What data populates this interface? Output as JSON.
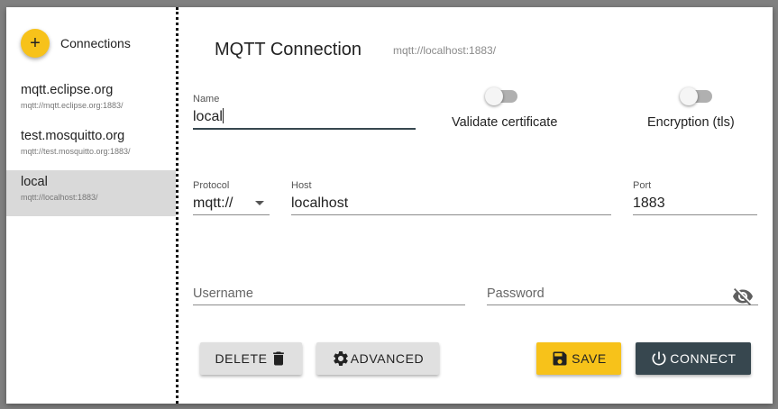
{
  "sidebar": {
    "title": "Connections",
    "add_icon": "plus-icon",
    "connections": [
      {
        "name": "mqtt.eclipse.org",
        "url": "mqtt://mqtt.eclipse.org:1883/"
      },
      {
        "name": "test.mosquitto.org",
        "url": "mqtt://test.mosquitto.org:1883/"
      },
      {
        "name": "local",
        "url": "mqtt://localhost:1883/",
        "selected": true
      }
    ]
  },
  "main": {
    "title": "MQTT Connection",
    "url": "mqtt://localhost:1883/",
    "name_field": {
      "label": "Name",
      "value": "local"
    },
    "validate_certificate": {
      "label": "Validate certificate",
      "enabled": false
    },
    "encryption": {
      "label": "Encryption (tls)",
      "enabled": false
    },
    "protocol": {
      "label": "Protocol",
      "value": "mqtt://"
    },
    "host": {
      "label": "Host",
      "value": "localhost"
    },
    "port": {
      "label": "Port",
      "value": "1883"
    },
    "username": {
      "placeholder": "Username"
    },
    "password": {
      "placeholder": "Password",
      "icon": "visibility-off-icon"
    }
  },
  "buttons": {
    "delete": {
      "label": "DELETE",
      "icon": "trash-icon"
    },
    "advanced": {
      "label": "ADVANCED",
      "icon": "gear-icon"
    },
    "save": {
      "label": "SAVE",
      "icon": "floppy-disk-icon"
    },
    "connect": {
      "label": "CONNECT",
      "icon": "power-icon"
    }
  },
  "colors": {
    "accent_yellow": "#f7c21a",
    "primary_dark": "#37474f",
    "selected_item": "#d9d9d9"
  }
}
